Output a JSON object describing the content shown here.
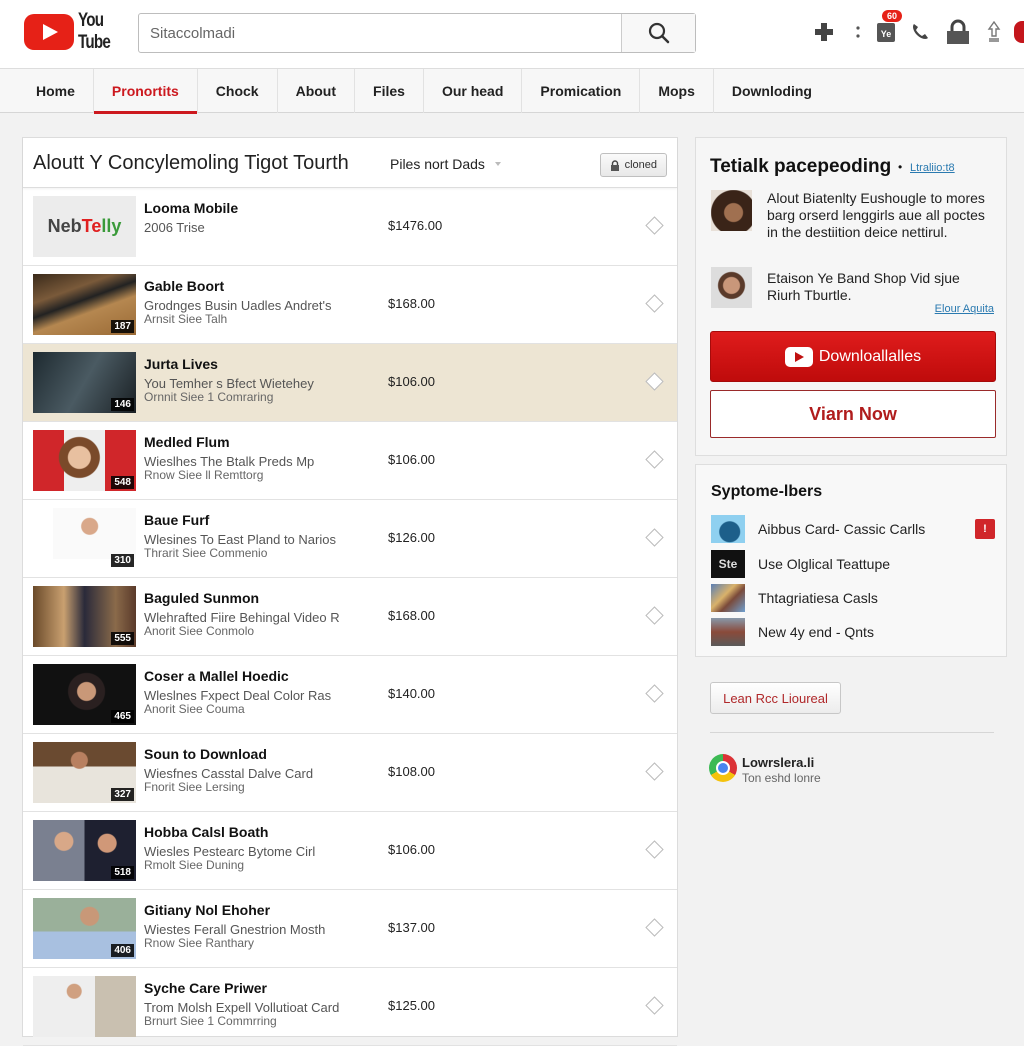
{
  "header": {
    "logo_line1": "You",
    "logo_line2": "Tube",
    "search_value": "Sitaccolmadi",
    "search_placeholder": "Search",
    "notification_count": "60",
    "icons": [
      "plus-icon",
      "more-vertical-icon",
      "notifications-icon",
      "phone-icon",
      "lock-icon",
      "upload-icon",
      "account-avatar"
    ]
  },
  "nav": {
    "items": [
      {
        "label": "Home",
        "active": false
      },
      {
        "label": "Pronortits",
        "active": true
      },
      {
        "label": "Chock",
        "active": false
      },
      {
        "label": "About",
        "active": false
      },
      {
        "label": "Files",
        "active": false
      },
      {
        "label": "Our head",
        "active": false
      },
      {
        "label": "Promication",
        "active": false
      },
      {
        "label": "Mops",
        "active": false
      },
      {
        "label": "Downloding",
        "active": false
      }
    ]
  },
  "main": {
    "title": "Aloutt Y Concylemoling Tigot Tourth",
    "filter_label": "Piles nort Dads",
    "lock_button": "cloned",
    "rows": [
      {
        "title": "Looma Mobile",
        "line1": "2006 Trise",
        "line2": "",
        "price": "$1476.00",
        "duration": "",
        "thumb": "logo",
        "logo_text": "NebTelly",
        "highlight": false
      },
      {
        "title": "Gable Boort",
        "line1": "Grodnges Busin Uadles Andret's",
        "line2": "Arnsit Siee Talh",
        "price": "$168.00",
        "duration": "187",
        "thumb": "keyboard",
        "highlight": false
      },
      {
        "title": "Jurta Lives",
        "line1": "You Temher s Bfect Wietehey",
        "line2": "Ornnit Siee 1 Comraring",
        "price": "$106.00",
        "duration": "146",
        "thumb": "dark",
        "highlight": true
      },
      {
        "title": "Medled Flum",
        "line1": "Wieslhes The Btalk Preds Mp",
        "line2": "Rnow Siee ll Remttorg",
        "price": "$106.00",
        "duration": "548",
        "thumb": "woman",
        "highlight": false
      },
      {
        "title": "Baue Furf",
        "line1": "Wlesines To East Pland to Narios",
        "line2": "Thrarit Siee Commenio",
        "price": "$126.00",
        "duration": "310",
        "thumb": "suit",
        "highlight": false
      },
      {
        "title": "Baguled Sunmon",
        "line1": "Wlehrafted Fiire Behingal Video R",
        "line2": "Anorit Siee Conmolo",
        "price": "$168.00",
        "duration": "555",
        "thumb": "room",
        "highlight": false
      },
      {
        "title": "Coser a Mallel Hoedic",
        "line1": "Wleslnes Fxpect Deal Color Ras",
        "line2": "Anorit Siee Couma",
        "price": "$140.00",
        "duration": "465",
        "thumb": "dark-suit",
        "highlight": false
      },
      {
        "title": "Soun to Download",
        "line1": "Wiesfnes Casstal Dalve Card",
        "line2": "Fnorit Siee Lersing",
        "price": "$108.00",
        "duration": "327",
        "thumb": "gesture",
        "highlight": false
      },
      {
        "title": "Hobba Calsl Boath",
        "line1": "Wiesles Pestearc Bytome Cirl",
        "line2": "Rmolt Siee Duning",
        "price": "$106.00",
        "duration": "518",
        "thumb": "two-men",
        "highlight": false
      },
      {
        "title": "Gitiany Nol Ehoher",
        "line1": "Wiestes Ferall Gnestrion Mosth",
        "line2": "Rnow Siee Ranthary",
        "price": "$137.00",
        "duration": "406",
        "thumb": "office",
        "highlight": false
      },
      {
        "title": "Syche Care Priwer",
        "line1": "Trom Molsh Expell Vollutioat Card",
        "line2": "Brnurt Siee 1 Commrring",
        "price": "$125.00",
        "duration": "",
        "thumb": "speaker",
        "highlight": false
      }
    ]
  },
  "sidebar": {
    "promo": {
      "title": "Tetialk pacepeoding",
      "link": "Ltraliio:t8",
      "entries": [
        {
          "text": "Alout Biatenlty Eushougle to mores barg orserd lenggirls aue all poctes in the destiition deice nettirul."
        },
        {
          "text": "Etaison Ye Band Shop Vid sjue Riurh Tburtle."
        }
      ],
      "more_link": "Elour Aquita",
      "download_button": "Downloallalles",
      "view_button": "Viarn Now"
    },
    "subscriptions": {
      "title": "Syptome-lbers",
      "items": [
        {
          "label": "Aibbus Card- Cassic Carlls",
          "thumb": "blue",
          "flag": true
        },
        {
          "label": "Use Olglical Teattupe",
          "thumb": "ste",
          "thumb_text": "Ste",
          "flag": false
        },
        {
          "label": "Thtagriatiesa Casls",
          "thumb": "art",
          "flag": false
        },
        {
          "label": "New 4y end - Qnts",
          "thumb": "landscape",
          "flag": false
        }
      ]
    },
    "learn_button": "Lean Rcc Lioureal",
    "browser": {
      "title": "Lowrslera.li",
      "subtitle": "Ton eshd lonre"
    }
  },
  "colors": {
    "brand_red": "#e62117",
    "nav_active": "#cc181e",
    "highlight_row": "#ede5d3",
    "link_blue": "#2a7ab0"
  }
}
